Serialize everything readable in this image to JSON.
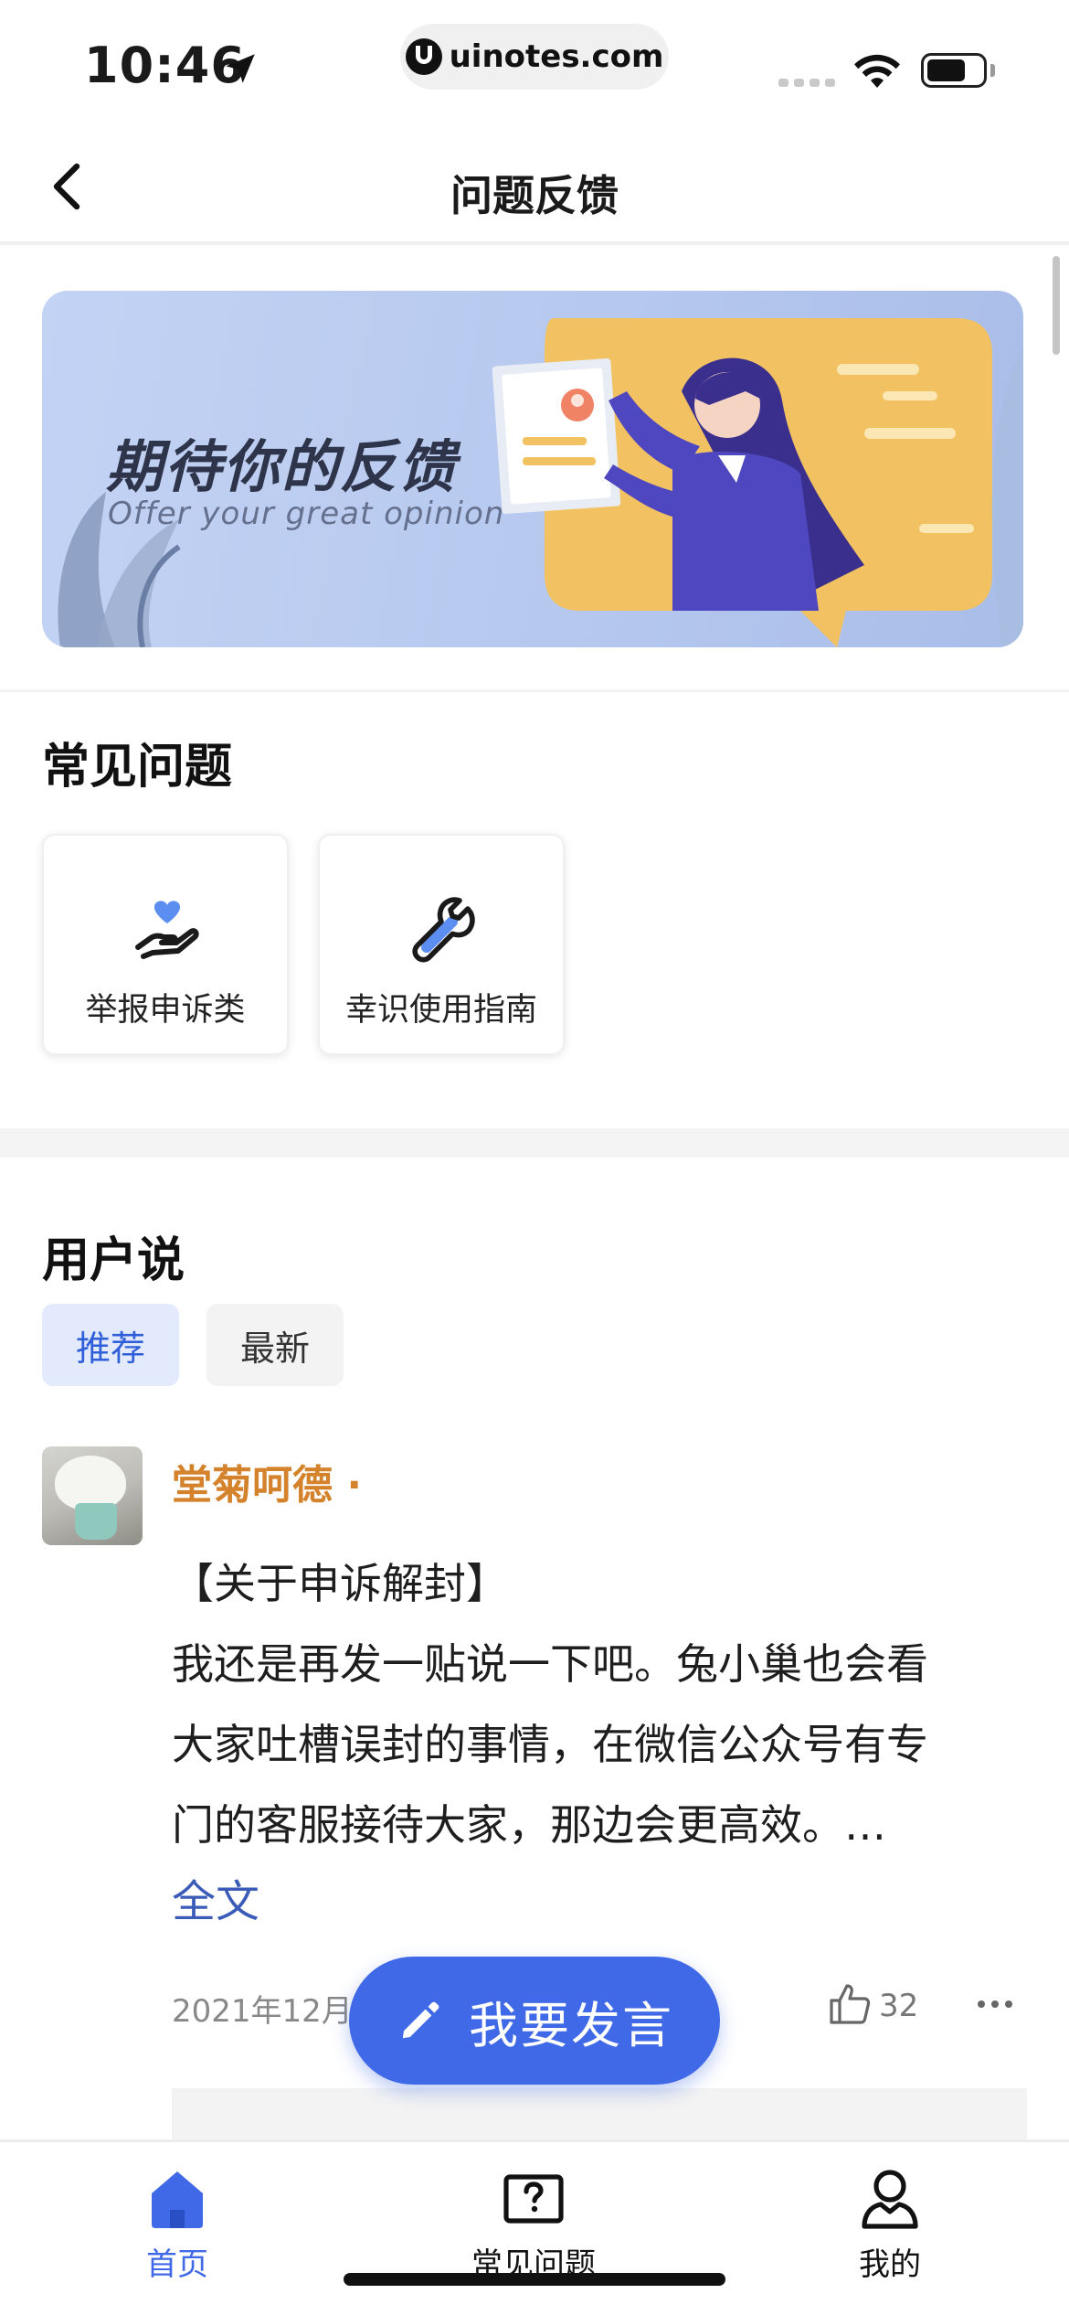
{
  "status_bar": {
    "time": "10:46",
    "url": "uinotes.com",
    "icons": [
      "location-arrow-icon",
      "signal-icon",
      "wifi-icon",
      "battery-icon"
    ]
  },
  "nav": {
    "title": "问题反馈",
    "back_icon": "chevron-left-icon"
  },
  "banner": {
    "title": "期待你的反馈",
    "subtitle": "Offer your great opinion"
  },
  "faq": {
    "title": "常见问题",
    "cards": [
      {
        "label": "举报申诉类",
        "icon": "hand-heart-icon"
      },
      {
        "label": "幸识使用指南",
        "icon": "wrench-icon"
      }
    ]
  },
  "user_says": {
    "title": "用户说",
    "tabs": [
      {
        "label": "推荐",
        "active": true
      },
      {
        "label": "最新",
        "active": false
      }
    ]
  },
  "post": {
    "username": "堂菊呵德 ·",
    "lines": [
      "【关于申诉解封】",
      "我还是再发一贴说一下吧。兔小巢也会看",
      "大家吐槽误封的事情，在微信公众号有专",
      "门的客服接待大家，那边会更高效。…"
    ],
    "full_text_label": "全文",
    "date": "2021年12月1",
    "like_count": "32"
  },
  "fab": {
    "label": "我要发言",
    "icon": "pencil-icon"
  },
  "tab_bar": {
    "items": [
      {
        "label": "首页",
        "icon": "home-icon",
        "active": true
      },
      {
        "label": "常见问题",
        "icon": "question-box-icon",
        "active": false
      },
      {
        "label": "我的",
        "icon": "person-icon",
        "active": false
      }
    ]
  },
  "colors": {
    "accent": "#3f69e6",
    "username": "#d4832c",
    "link": "#3a5bb8",
    "banner_bg": "#b9cbee"
  }
}
